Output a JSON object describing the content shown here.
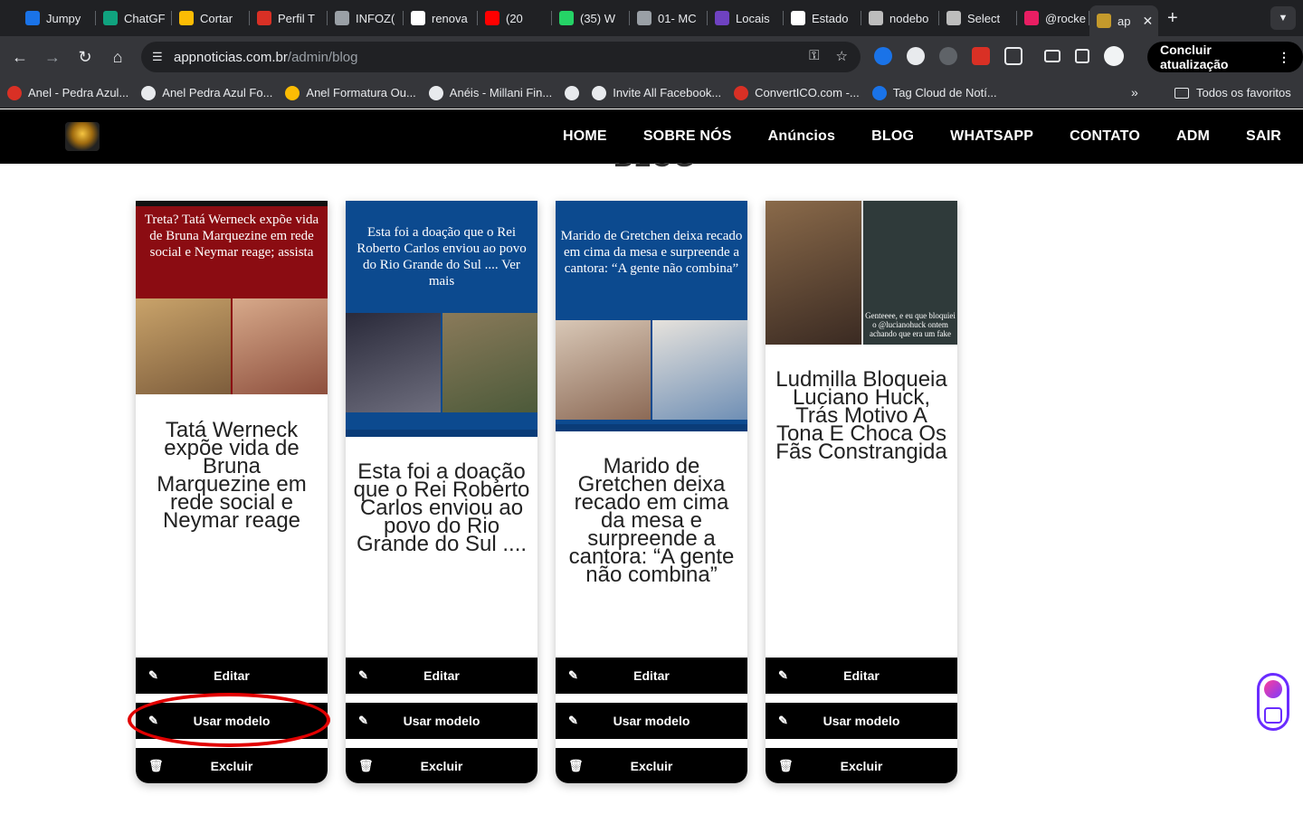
{
  "browser": {
    "tabs": [
      {
        "label": "Jumpy",
        "color": "#1a73e8"
      },
      {
        "label": "ChatGF",
        "color": "#10a37f"
      },
      {
        "label": "Cortar",
        "color": "#fbbc04"
      },
      {
        "label": "Perfil T",
        "color": "#d93025"
      },
      {
        "label": "INFOZ(",
        "color": "#9aa0a6"
      },
      {
        "label": "renova",
        "color": "#ffffff"
      },
      {
        "label": "(20",
        "color": "#ff0000"
      },
      {
        "label": "(35) W",
        "color": "#25d366"
      },
      {
        "label": "01- MC",
        "color": "#9aa0a6"
      },
      {
        "label": "Locais",
        "color": "#6f42c1"
      },
      {
        "label": "Estado",
        "color": "#ffffff"
      },
      {
        "label": "nodebo",
        "color": "#bdbdbd"
      },
      {
        "label": "Select",
        "color": "#bdbdbd"
      },
      {
        "label": "@rocke",
        "color": "#e91e63"
      },
      {
        "label": "ap",
        "color": "#c49a2c"
      }
    ],
    "new_tab": "+",
    "url_host": "appnoticias.com.br",
    "url_path": "/admin/blog",
    "update_button": "Concluir atualização",
    "bookmarks": [
      {
        "label": "Anel - Pedra Azul...",
        "color": "#d93025"
      },
      {
        "label": "Anel Pedra Azul Fo...",
        "color": "#e8eaed"
      },
      {
        "label": "Anel Formatura Ou...",
        "color": "#fbbc04"
      },
      {
        "label": "Anéis - Millani Fin...",
        "color": "#e8eaed"
      },
      {
        "label": "",
        "color": "#e8eaed"
      },
      {
        "label": "Invite All Facebook...",
        "color": "#e8eaed"
      },
      {
        "label": "ConvertICO.com -...",
        "color": "#d93025"
      },
      {
        "label": "Tag Cloud de Notí...",
        "color": "#1a73e8"
      }
    ],
    "bookmarks_more": "»",
    "all_bookmarks": "Todos os favoritos"
  },
  "site": {
    "menu": [
      "HOME",
      "SOBRE NÓS",
      "Anúncios",
      "BLOG",
      "WHATSAPP",
      "CONTATO",
      "ADM",
      "SAIR"
    ],
    "heading": "BLOG"
  },
  "posts": [
    {
      "caption": "Treta? Tatá Werneck expõe vida de Bruna Marquezine em rede social e Neymar reage; assista",
      "title": "Tatá Werneck expõe vida de Bruna Marquezine em rede social e Neymar reage",
      "bg": "#8b0c12"
    },
    {
      "caption": "Esta foi a doação que o Rei Roberto Carlos enviou ao povo do Rio Grande do Sul .... Ver mais",
      "title": "Esta foi a doação que o Rei Roberto Carlos enviou ao povo do Rio Grande do Sul ....",
      "bg": "#0c4a8f"
    },
    {
      "caption": "Marido de Gretchen deixa recado em cima da mesa e surpreende a cantora: “A gente não combina”",
      "title": "Marido de Gretchen deixa recado em cima da mesa e surpreende a cantora: “A gente não combina”",
      "bg": "#0c4a8f"
    },
    {
      "caption": "Genteeee, e eu que bloquiei o @lucianohuck ontem achando que era um fake",
      "title": "Ludmilla Bloqueia Luciano Huck, Trás Motivo A Tona E Choca Os Fãs Constrangida",
      "bg": "#dcdcdc"
    }
  ],
  "actions": {
    "edit": "Editar",
    "use_template": "Usar modelo",
    "delete": "Excluir"
  },
  "colors": {
    "nav_bg": "#000000",
    "button_bg": "#000000",
    "highlight": "#e10000",
    "widget": "#6a2cff"
  }
}
